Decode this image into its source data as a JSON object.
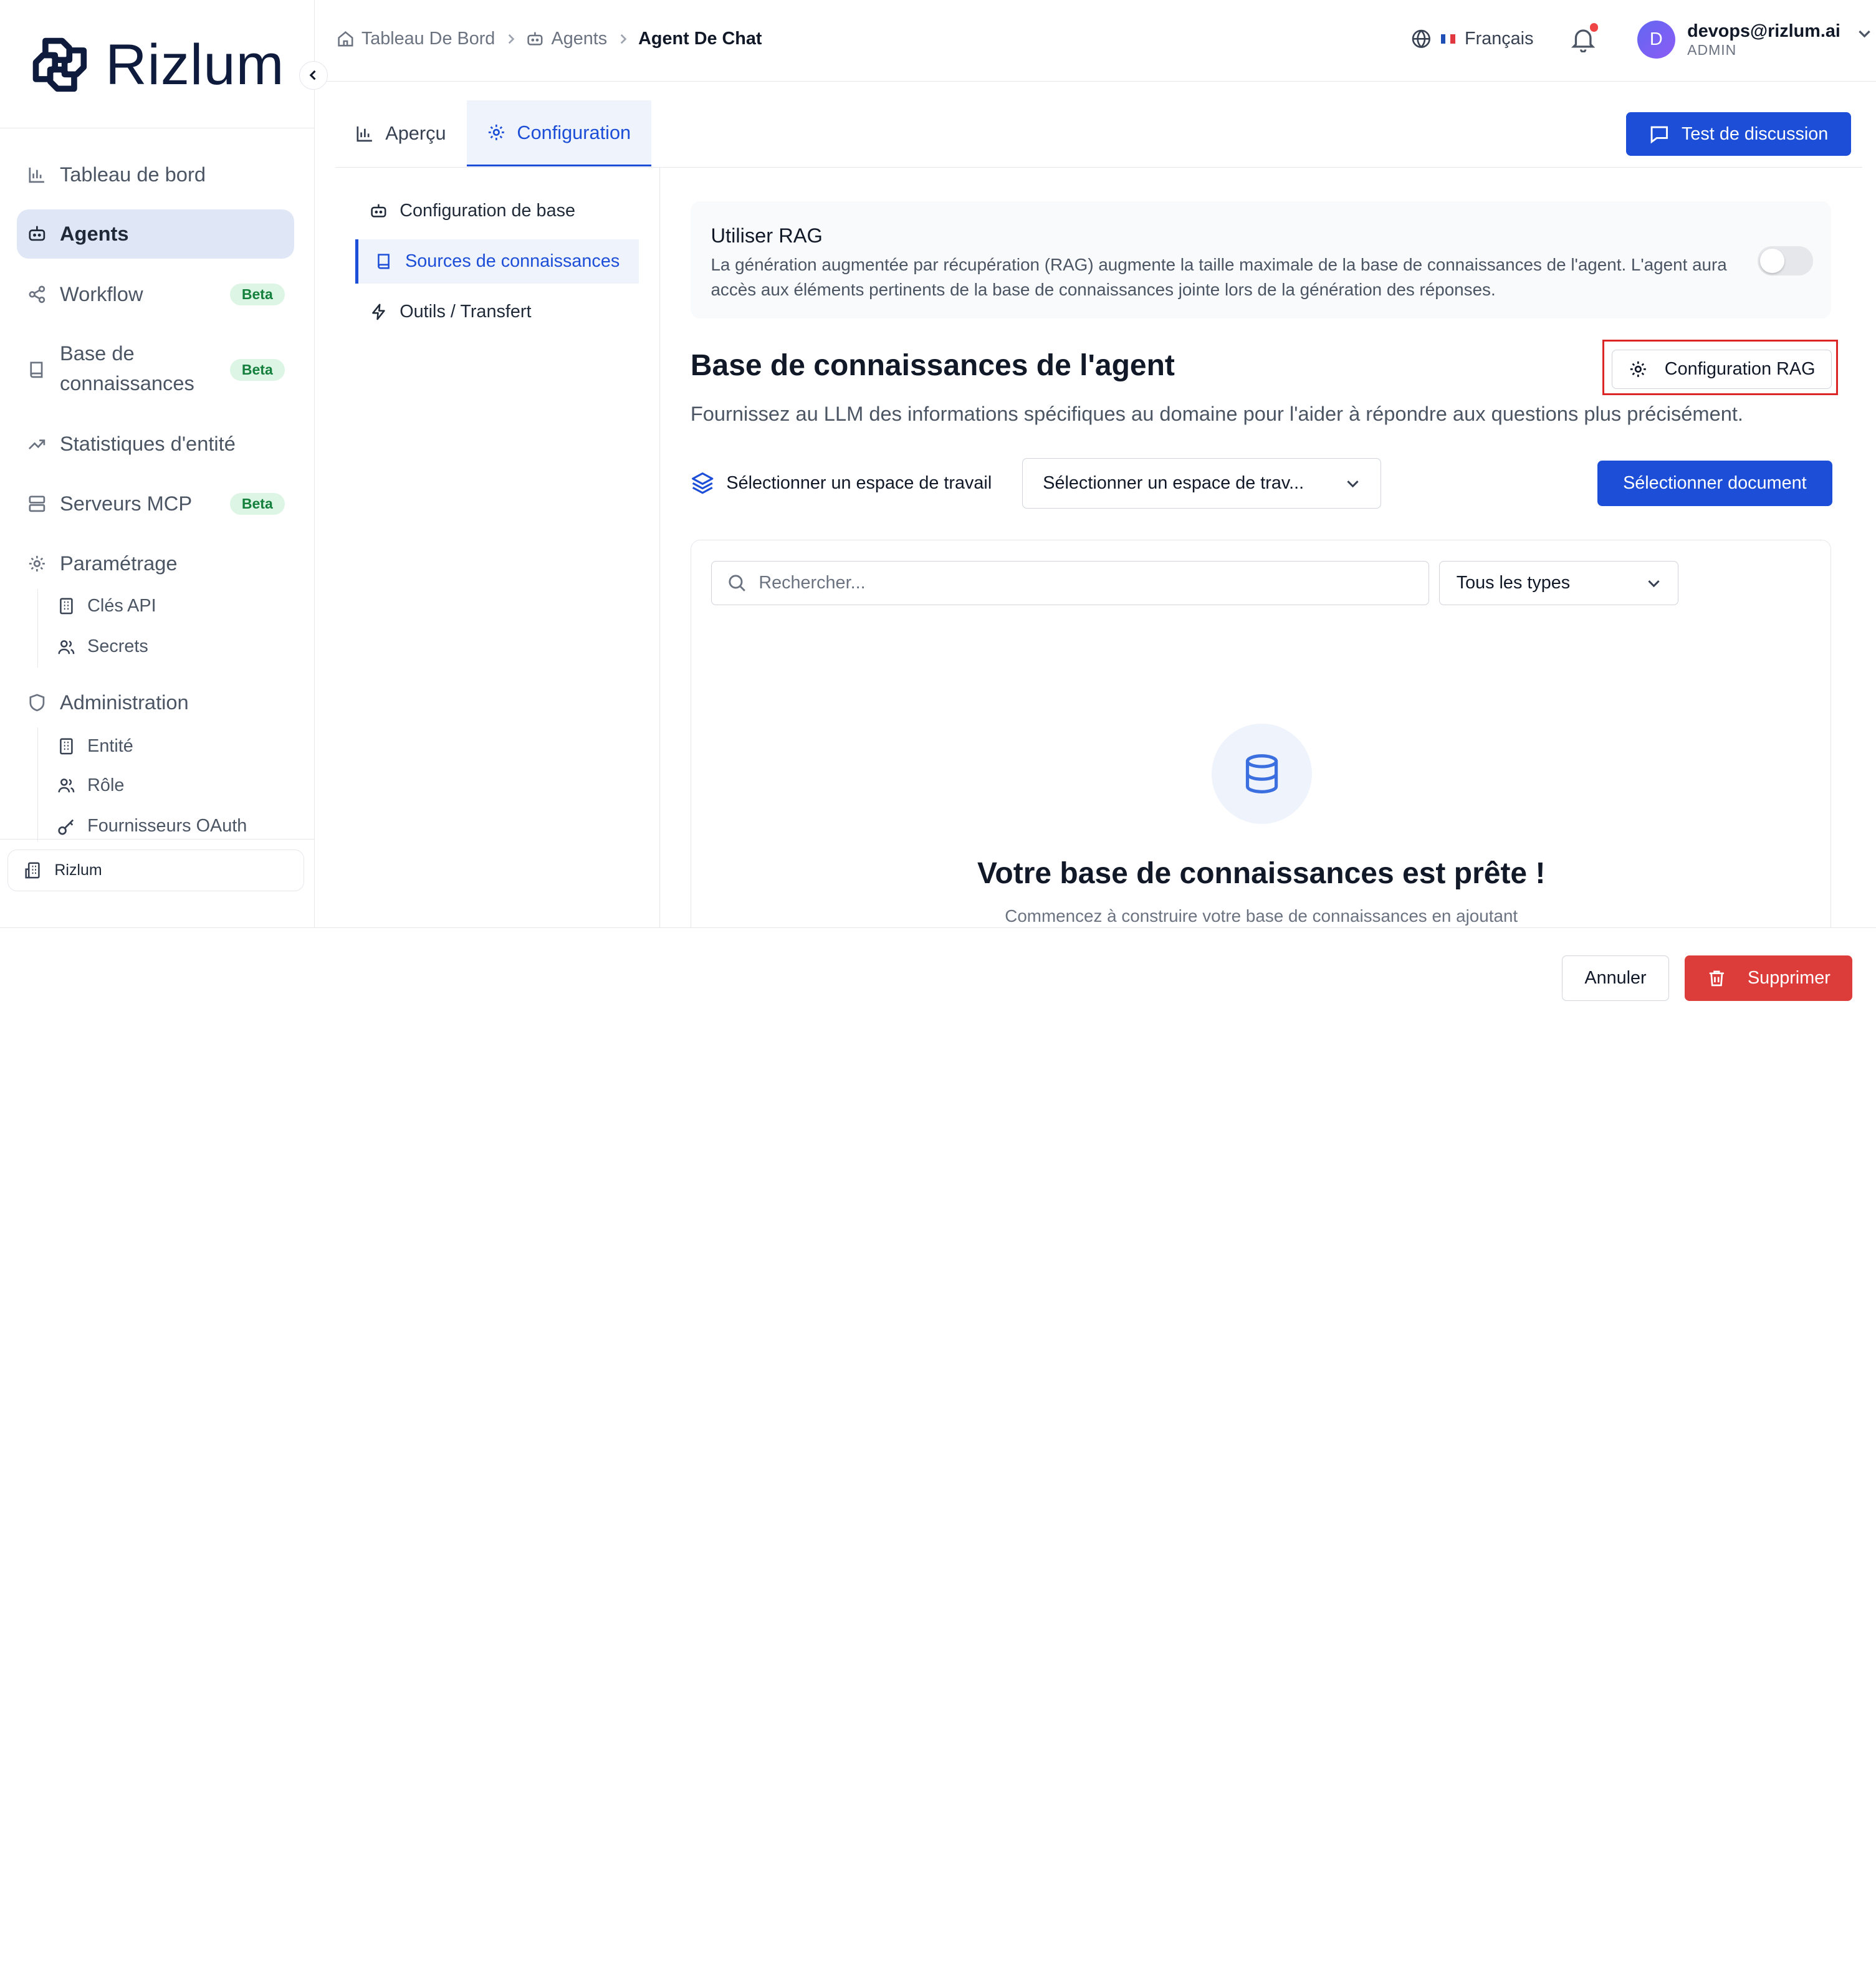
{
  "brand": {
    "name": "Rizlum",
    "color": "#0f1b3d"
  },
  "sidebar": {
    "items": [
      {
        "label": "Tableau de bord",
        "icon": "bar-chart-icon"
      },
      {
        "label": "Agents",
        "icon": "bot-icon",
        "active": true
      },
      {
        "label": "Workflow",
        "icon": "share-nodes-icon",
        "badge": "Beta"
      },
      {
        "label": "Base de",
        "label2": "connaissances",
        "icon": "book-icon",
        "badge": "Beta"
      },
      {
        "label": "Statistiques d'entité",
        "icon": "trending-up-icon"
      },
      {
        "label": "Serveurs MCP",
        "icon": "server-icon",
        "badge": "Beta"
      },
      {
        "label": "Paramétrage",
        "icon": "gear-icon"
      },
      {
        "label": "Administration",
        "icon": "shield-icon"
      }
    ],
    "settings_sub": [
      {
        "label": "Clés API",
        "icon": "building-icon"
      },
      {
        "label": "Secrets",
        "icon": "users-icon"
      }
    ],
    "admin_sub": [
      {
        "label": "Entité",
        "icon": "building-icon"
      },
      {
        "label": "Rôle",
        "icon": "users-icon"
      },
      {
        "label": "Fournisseurs OAuth",
        "icon": "key-icon"
      }
    ],
    "org": "Rizlum"
  },
  "header": {
    "breadcrumb": [
      "Tableau De Bord",
      "Agents",
      "Agent De Chat"
    ],
    "language": "Français",
    "user_email": "devops@rizlum.ai",
    "user_role": "ADMIN",
    "avatar_initial": "D"
  },
  "tabs": [
    {
      "label": "Aperçu",
      "icon": "bar-chart-icon"
    },
    {
      "label": "Configuration",
      "icon": "gear-icon",
      "active": true
    }
  ],
  "chat_test_button": "Test de discussion",
  "subnav": [
    {
      "label": "Configuration de base",
      "icon": "bot-icon"
    },
    {
      "label": "Sources de connaissances",
      "icon": "book-icon",
      "active": true
    },
    {
      "label": "Outils / Transfert",
      "icon": "zap-icon"
    }
  ],
  "rag": {
    "title": "Utiliser RAG",
    "description": "La génération augmentée par récupération (RAG) augmente la taille maximale de la base de connaissances de l'agent. L'agent aura accès aux éléments pertinents de la base de connaissances jointe lors de la génération des réponses.",
    "enabled": false
  },
  "knowledge": {
    "title": "Base de connaissances de l'agent",
    "description": "Fournissez au LLM des informations spécifiques au domaine pour l'aider à répondre aux questions plus précisément.",
    "rag_config_button": "Configuration RAG",
    "workspace_label": "Sélectionner un espace de travail",
    "workspace_select": "Sélectionner un espace de trav...",
    "select_document_button": "Sélectionner document",
    "search_placeholder": "Rechercher...",
    "type_filter": "Tous les types",
    "empty_title": "Votre base de connaissances est prête !",
    "empty_subtitle": "Commencez à construire votre base de connaissances en ajoutant"
  },
  "footer": {
    "cancel": "Annuler",
    "delete": "Supprimer"
  },
  "colors": {
    "primary": "#1d4ed8",
    "danger": "#dc3d3a",
    "highlight": "#dc2626",
    "beta_bg": "#dcf5e4",
    "beta_text": "#15803d"
  }
}
